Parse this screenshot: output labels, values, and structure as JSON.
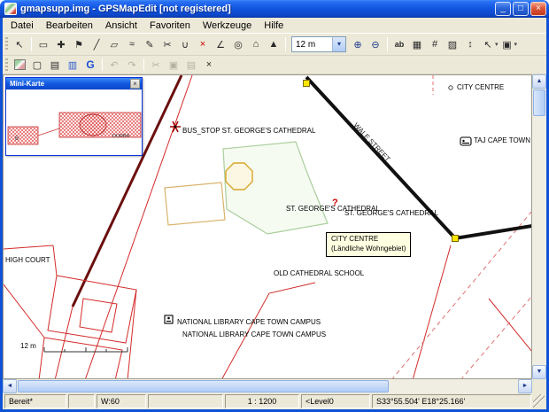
{
  "window": {
    "title": "gmapsupp.img - GPSMapEdit [not registered]",
    "minimize_glyph": "_",
    "maximize_glyph": "□",
    "close_glyph": "×"
  },
  "menu": {
    "items": [
      "Datei",
      "Bearbeiten",
      "Ansicht",
      "Favoriten",
      "Werkzeuge",
      "Hilfe"
    ]
  },
  "toolbar_main": {
    "tools": [
      {
        "name": "select-tool",
        "glyph": "↖"
      },
      {
        "name": "zoom-window-tool",
        "glyph": "▭"
      },
      {
        "name": "pan-tool",
        "glyph": "✚"
      },
      {
        "name": "add-point-tool",
        "glyph": "⚑"
      },
      {
        "name": "add-polyline-tool",
        "glyph": "╱"
      },
      {
        "name": "add-polygon-tool",
        "glyph": "▱"
      },
      {
        "name": "add-road-tool",
        "glyph": "≈"
      },
      {
        "name": "edit-nodes-tool",
        "glyph": "✎"
      },
      {
        "name": "split-tool",
        "glyph": "✂"
      },
      {
        "name": "join-tool",
        "glyph": "∪"
      },
      {
        "name": "delete-object-tool",
        "glyph": "×"
      },
      {
        "name": "measure-tool",
        "glyph": "∠"
      },
      {
        "name": "find-tool",
        "glyph": "◎"
      },
      {
        "name": "address-tool",
        "glyph": "⌂"
      },
      {
        "name": "gps-tool",
        "glyph": "▲"
      }
    ],
    "zoom_value": "12 m",
    "dropdown_glyph": "▾",
    "zoom_in_glyph": "⊕",
    "zoom_out_glyph": "⊖",
    "right_tools": [
      {
        "name": "labels-toggle",
        "glyph": "ab"
      },
      {
        "name": "grid-toggle",
        "glyph": "▦"
      },
      {
        "name": "graticule-toggle",
        "glyph": "#"
      },
      {
        "name": "hatch-toggle",
        "glyph": "▨"
      },
      {
        "name": "levels-toggle",
        "glyph": "↕"
      },
      {
        "name": "select-mode",
        "glyph": "↖"
      },
      {
        "name": "view-mode",
        "glyph": "▣"
      }
    ]
  },
  "toolbar_file": {
    "icons": [
      {
        "name": "open-map",
        "glyph": ""
      },
      {
        "name": "new-map",
        "glyph": "▢"
      },
      {
        "name": "save-map",
        "glyph": "▤"
      },
      {
        "name": "statistics",
        "glyph": "▥"
      },
      {
        "name": "google-earth",
        "glyph": "G"
      },
      {
        "name": "undo",
        "glyph": "↶"
      },
      {
        "name": "redo",
        "glyph": "↷"
      },
      {
        "name": "cut",
        "glyph": "✂"
      },
      {
        "name": "copy",
        "glyph": "▣"
      },
      {
        "name": "paste",
        "glyph": "▤"
      },
      {
        "name": "delete",
        "glyph": "×"
      }
    ]
  },
  "minimap": {
    "title": "Mini-Karte",
    "close_glyph": "×",
    "label_b": "B",
    "label_durban": "DURBA"
  },
  "map": {
    "labels": [
      {
        "text": "BUS_STOP ST. GEORGE'S CATHEDRAL"
      },
      {
        "text": "CITY CENTRE"
      },
      {
        "text": "TAJ CAPE TOWN HOT"
      },
      {
        "text": "WALE STREET"
      },
      {
        "text": "ST. GEORGE'S CATHEDRAL"
      },
      {
        "text": "ST. GEORGE'S CATHEDRAL"
      },
      {
        "text": "OLD CATHEDRAL SCHOOL"
      },
      {
        "text": "HIGH COURT"
      },
      {
        "text": "NATIONAL LIBRARY CAPE TOWN CAMPUS"
      },
      {
        "text": "NATIONAL LIBRARY CAPE TOWN CAMPUS"
      }
    ],
    "question_marker": "?",
    "tooltip": {
      "line1": "CITY CENTRE",
      "line2": "(Ländliche Wohngebiet)"
    },
    "scale_label": "12 m"
  },
  "scroll": {
    "up": "▲",
    "down": "▼",
    "left": "◄",
    "right": "►"
  },
  "statusbar": {
    "ready": "Bereit*",
    "w": "W:60",
    "scale": "1 : 1200",
    "level": "<Level0",
    "coords": "S33°55.504' E18°25.166'"
  },
  "colors": {
    "street_red": "#d42a2a",
    "road_black": "#111111",
    "maroon": "#6b0f0f",
    "node_yellow": "#ffe600",
    "tooltip_bg": "#ffffe1",
    "titlebar_blue": "#1157e0"
  }
}
